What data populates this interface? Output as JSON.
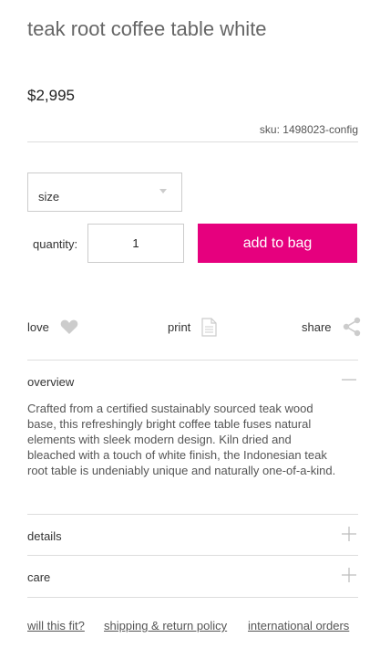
{
  "product": {
    "title": "teak root coffee table white",
    "price": "$2,995",
    "sku": "sku: 1498023-config"
  },
  "purchase": {
    "size_label": "size",
    "quantity_label": "quantity:",
    "quantity_value": "1",
    "add_button": "add to bag",
    "accent_color": "#e6007e"
  },
  "actions": {
    "love": {
      "label": "love",
      "icon": "heart-icon"
    },
    "print": {
      "label": "print",
      "icon": "document-icon"
    },
    "share": {
      "label": "share",
      "icon": "share-icon"
    }
  },
  "sections": {
    "overview": {
      "label": "overview",
      "expanded": true,
      "icon": "minus-icon",
      "body": "Crafted from a certified sustainably sourced teak wood base, this refreshingly bright coffee table fuses natural elements with sleek modern design. Kiln dried and bleached with a touch of white finish, the Indonesian teak root table is undeniably unique and naturally one-of-a-kind."
    },
    "details": {
      "label": "details",
      "expanded": false,
      "icon": "plus-icon"
    },
    "care": {
      "label": "care",
      "expanded": false,
      "icon": "plus-icon"
    }
  },
  "footer_links": {
    "fit": "will this fit?",
    "shipping": "shipping & return policy",
    "international": "international orders"
  }
}
